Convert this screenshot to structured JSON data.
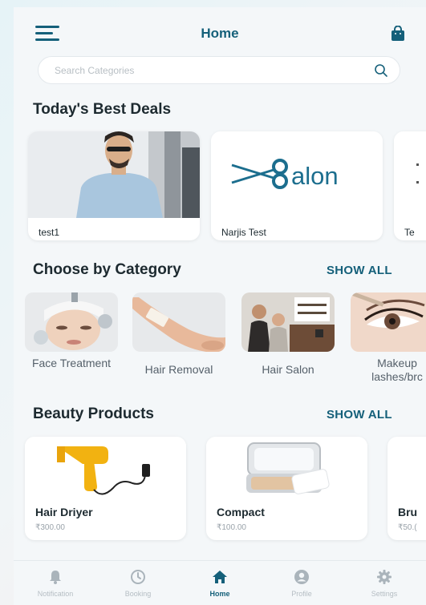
{
  "header": {
    "title": "Home"
  },
  "search": {
    "placeholder": "Search Categories"
  },
  "deals": {
    "title": "Today's Best Deals",
    "items": [
      {
        "label": "test1"
      },
      {
        "label": "Narjis Test",
        "logo_text": "alon"
      },
      {
        "label": "Te"
      }
    ]
  },
  "categories": {
    "title": "Choose by Category",
    "show_all": "SHOW ALL",
    "items": [
      {
        "label": "Face Treatment"
      },
      {
        "label": "Hair Removal"
      },
      {
        "label": "Hair Salon"
      },
      {
        "label": "Makeup lashes/brc"
      }
    ]
  },
  "products": {
    "title": "Beauty Products",
    "show_all": "SHOW ALL",
    "items": [
      {
        "name": "Hair Driyer",
        "price": "₹300.00"
      },
      {
        "name": "Compact",
        "price": "₹100.00"
      },
      {
        "name": "Bru",
        "price": "₹50.("
      }
    ]
  },
  "nav": {
    "items": [
      {
        "label": "Notification",
        "icon": "bell-icon"
      },
      {
        "label": "Booking",
        "icon": "clock-icon"
      },
      {
        "label": "Home",
        "icon": "home-icon",
        "active": true
      },
      {
        "label": "Profile",
        "icon": "profile-icon"
      },
      {
        "label": "Settings",
        "icon": "gear-icon"
      }
    ]
  },
  "colors": {
    "accent": "#15607a",
    "background": "#f4f7f9"
  }
}
